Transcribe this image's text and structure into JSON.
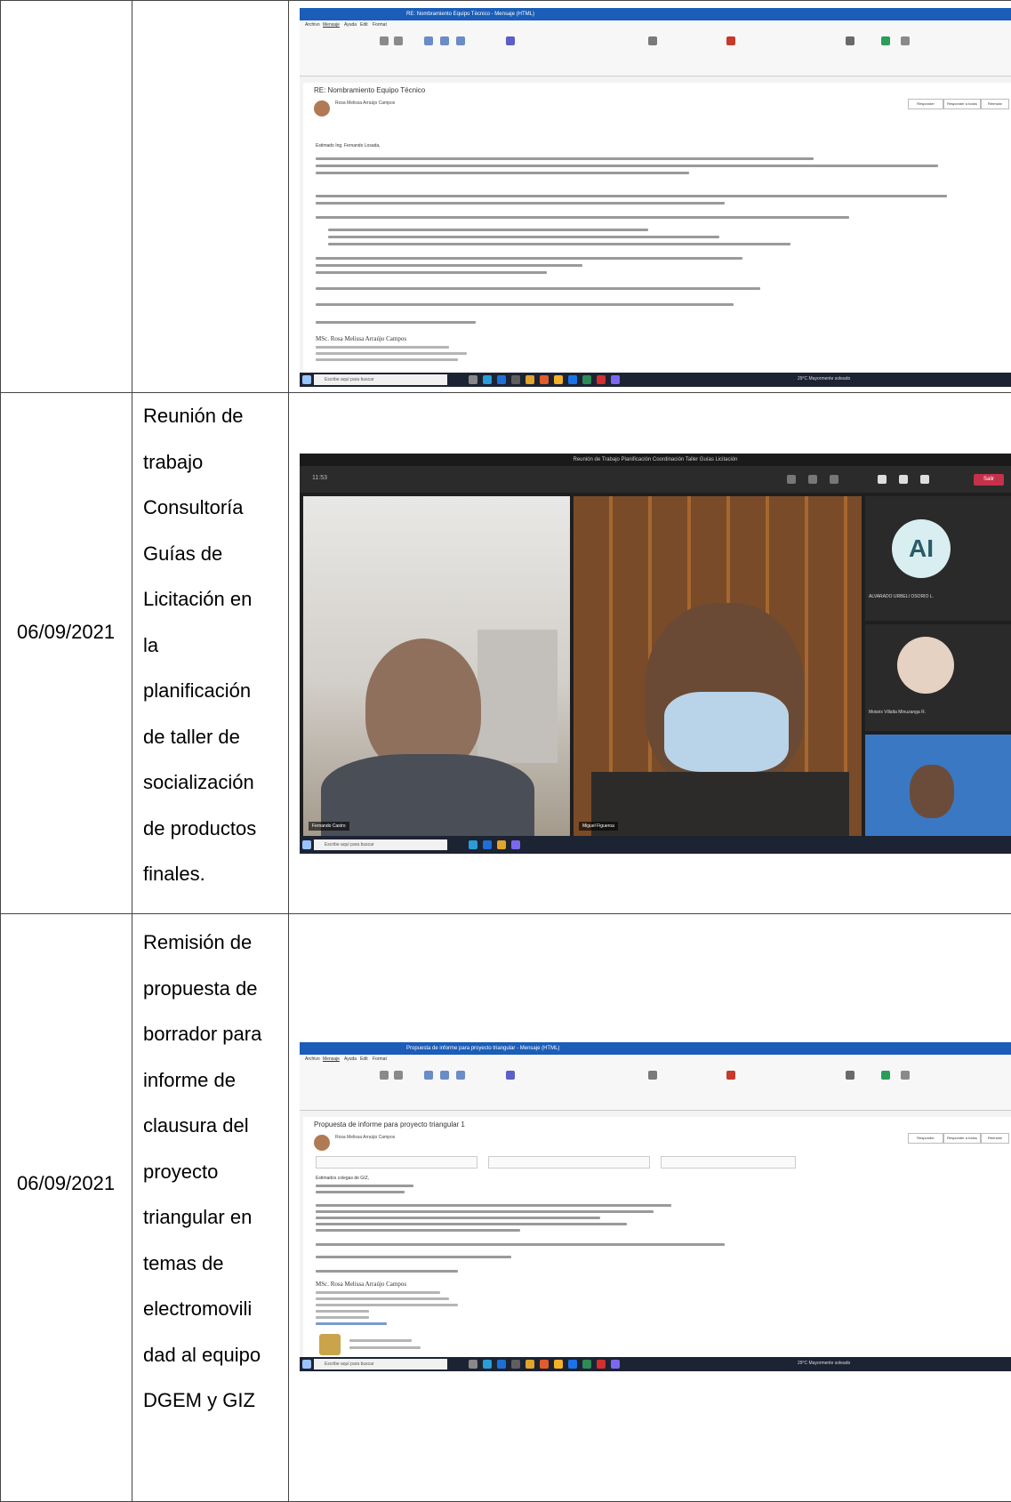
{
  "rows": [
    {
      "date": "",
      "description_lines": [],
      "screenshot": {
        "kind": "outlook",
        "window_title": "RE: Nombramiento Equipo Técnico - Mensaje (HTML)",
        "search": "Buscar",
        "tabs": [
          "Archivo",
          "Mensaje",
          "Ayuda",
          "Edit",
          "Format"
        ],
        "subject": "RE: Nombramiento Equipo Técnico",
        "sender": "Rosa Melissa Arraújo Campos",
        "greeting": "Estimado Ing. Fernando Losada,",
        "signature_name": "MSc. Rosa Melissa Arraújo Campos",
        "reply_buttons": [
          "Responder",
          "Responder a todos",
          "Reenviar"
        ]
      }
    },
    {
      "date": "06/09/2021",
      "description_lines": [
        "Reunión de",
        "trabajo",
        "Consultoría",
        "Guías de",
        "Licitación en",
        "la",
        "planificación",
        "de taller de",
        "socialización",
        "de productos",
        "finales."
      ],
      "screenshot": {
        "kind": "teams",
        "window_title": "Reunión de Trabajo Planificación Coordinación Taller Guías Licitación",
        "timer": "11:53",
        "leave_label": "Salir",
        "participant_initials": "AI",
        "participant_name": "ALVARADO URBELI OSORIO L.",
        "participant_names": [
          "Fernando Castro",
          "Miguel Figueroa",
          "Moisés Villalta Minuzanga R."
        ]
      }
    },
    {
      "date": "06/09/2021",
      "description_lines": [
        "Remisión de",
        "propuesta de",
        "borrador para",
        "informe de",
        "clausura del",
        "proyecto",
        "triangular en",
        "temas de",
        "electromovili",
        "dad al equipo",
        "DGEM y GIZ"
      ],
      "screenshot": {
        "kind": "outlook",
        "window_title": "Propuesta de informe para proyecto triangular - Mensaje (HTML)",
        "search": "Buscar",
        "tabs": [
          "Archivo",
          "Mensaje",
          "Ayuda",
          "Edit",
          "Format"
        ],
        "subject": "Propuesta de informe para proyecto triangular 1",
        "sender": "Rosa Melissa Arraújo Campos",
        "greeting": "Estimados colegas de GIZ,",
        "signature_name": "MSc. Rosa Melissa Arraújo Campos",
        "reply_buttons": [
          "Responder",
          "Responder a todos",
          "Reenviar"
        ]
      }
    }
  ],
  "taskbar": {
    "search_placeholder": "Escribe aquí para buscar",
    "weather": "29°C Mayormente soleado"
  }
}
